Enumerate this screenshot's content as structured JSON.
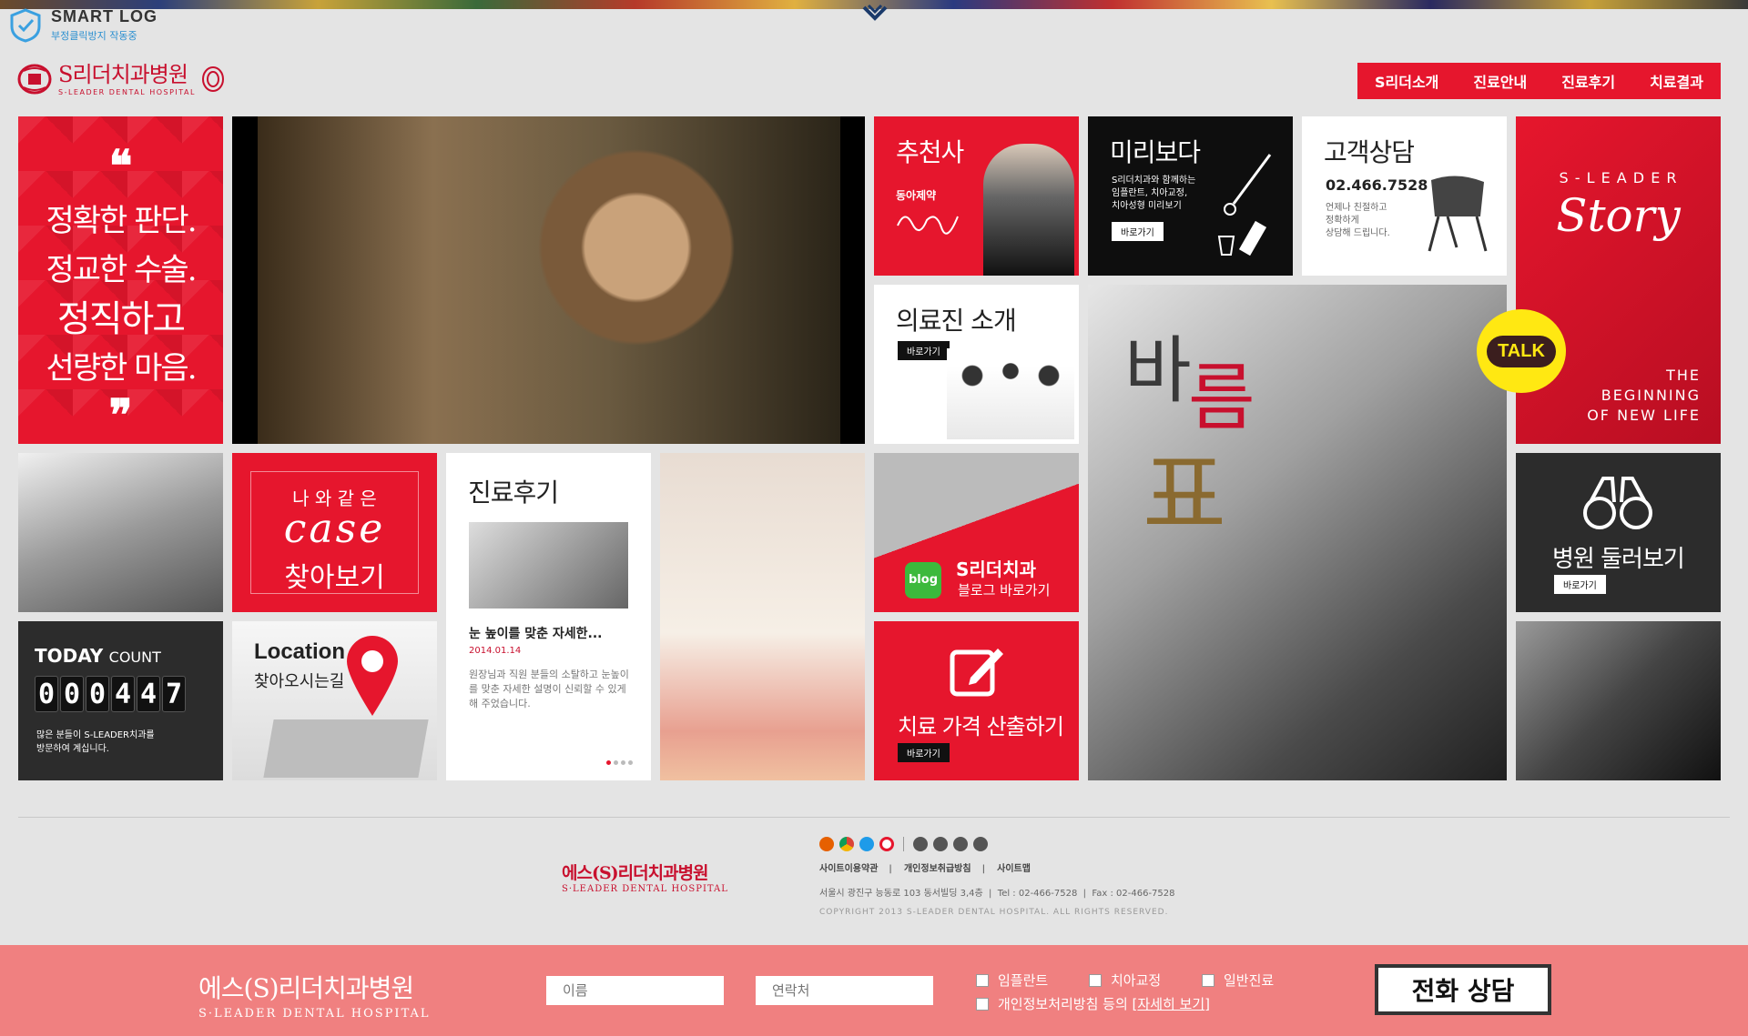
{
  "smartlog": {
    "title": "SMART LOG",
    "subtitle": "부정클릭방지 작동중"
  },
  "brand": {
    "name": "S리더치과병원",
    "sub": "S-LEADER DENTAL HOSPITAL",
    "color": "#c8102e"
  },
  "nav": {
    "items": [
      "S리더소개",
      "진료안내",
      "진료후기",
      "치료결과"
    ],
    "bg": "#e6162d"
  },
  "quote": {
    "open": "❝",
    "lines": [
      "정확한 판단.",
      "정교한 수술.",
      "정직하고",
      "선량한 마음."
    ],
    "close": "❞"
  },
  "recommender": {
    "title": "추천사",
    "company": "동아제약"
  },
  "preview": {
    "title": "미리보다",
    "desc": [
      "S리더치과와 함께하는",
      "임플란트, 치아교정,",
      "치아성형 미리보기"
    ],
    "button": "바로가기"
  },
  "consult": {
    "title": "고객상담",
    "phone": "02.466.7528",
    "desc": [
      "언제나 친절하고",
      "정확하게",
      "상담해 드립니다."
    ]
  },
  "story": {
    "letters": "S - L E A D E R",
    "title": "Story",
    "tagline": [
      "THE",
      "BEGINNING",
      "OF NEW LIFE"
    ]
  },
  "staff": {
    "title": "의료진 소개",
    "button": "바로가기"
  },
  "main_photo": {
    "text1": "바",
    "text2": "름",
    "text3": "표"
  },
  "kakao": {
    "label": "TALK"
  },
  "case": {
    "line1": "나 와 같 은",
    "line2": "case",
    "line3": "찾아보기"
  },
  "review": {
    "title": "진료후기",
    "headline": "눈 높이를 맞춘 자세한...",
    "date": "2014.01.14",
    "body": "원장님과 직원 분들의 소탈하고 눈높이를 맞춘 자세한 설명이 신뢰할 수 있게 해 주었습니다."
  },
  "blog": {
    "icon_label": "blog",
    "title": "S리더치과",
    "subtitle": "블로그 바로가기"
  },
  "tour": {
    "title": "병원 둘러보기",
    "button": "바로가기"
  },
  "today": {
    "label_bold": "TODAY",
    "label_light": "COUNT",
    "digits": [
      "0",
      "0",
      "0",
      "4",
      "4",
      "7"
    ],
    "desc": [
      "많은 분들이 S-LEADER치과를",
      "방문하여 계십니다."
    ]
  },
  "location": {
    "title": "Location",
    "subtitle": "찾아오시는길"
  },
  "price": {
    "title": "치료 가격 산출하기",
    "button": "바로가기"
  },
  "footer": {
    "logo_name": "에스(S)리더치과병원",
    "logo_sub": "S·LEADER DENTAL HOSPITAL",
    "links": [
      "사이트이용약관",
      "개인정보취급방침",
      "사이트맵"
    ],
    "address": "서울시 광진구 능동로 103 동서빌딩 3,4층",
    "tel": "Tel : 02-466-7528",
    "fax": "Fax : 02-466-7528",
    "copyright": "COPYRIGHT 2013 S-LEADER DENTAL HOSPITAL. ALL RIGHTS RESERVED."
  },
  "bottom_bar": {
    "logo_name": "에스(S)리더치과병원",
    "logo_sub": "S·LEADER DENTAL HOSPITAL",
    "name_placeholder": "이름",
    "phone_placeholder": "연락처",
    "options": [
      "임플란트",
      "치아교정",
      "일반진료"
    ],
    "agree_prefix": "개인정보처리방침 등의 [",
    "agree_link": "자세히 보기",
    "agree_suffix": "]",
    "call_button": "전화 상담",
    "bg": "#f08080"
  }
}
